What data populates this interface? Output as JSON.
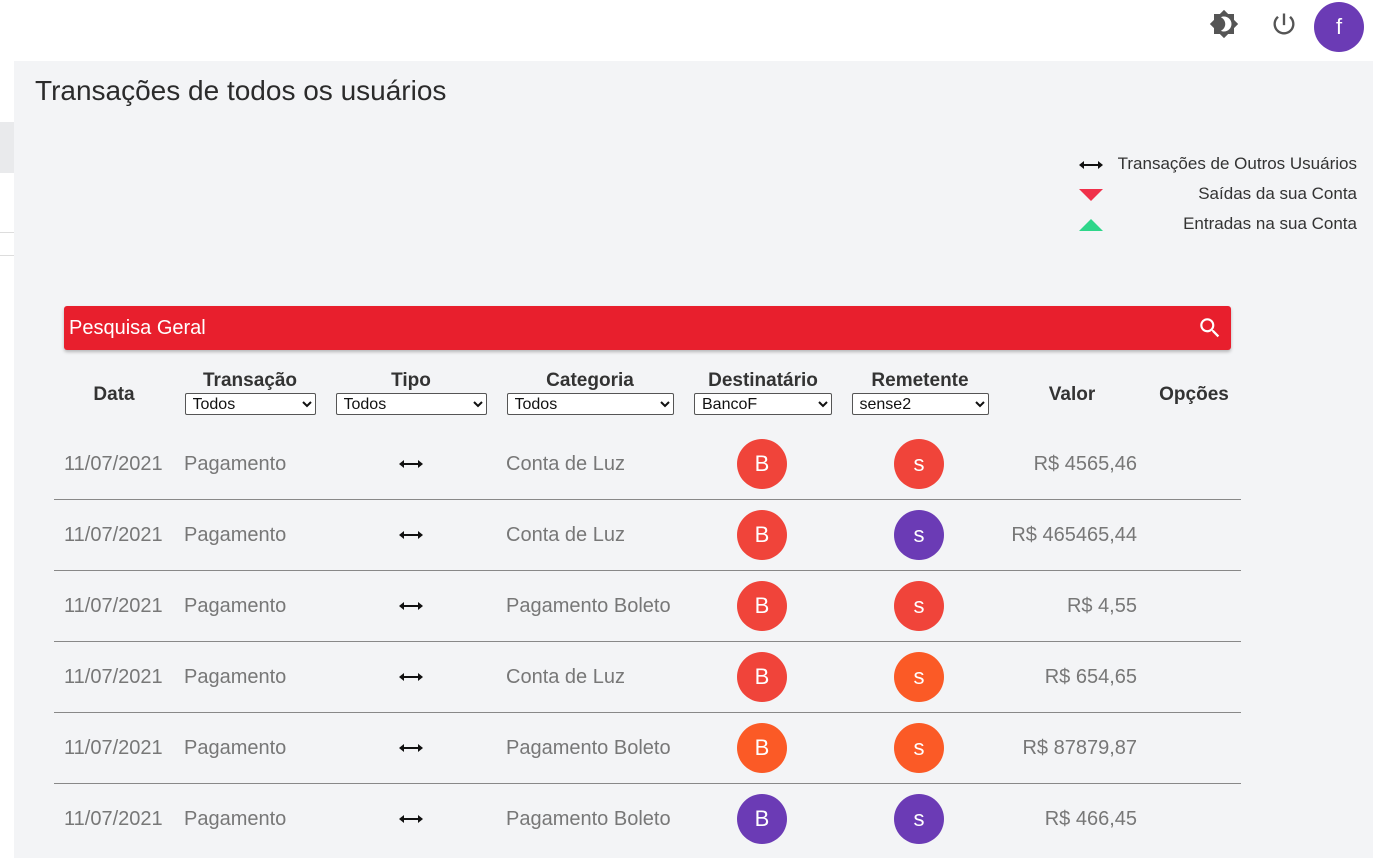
{
  "header": {
    "theme_icon": "brightness-icon",
    "power_icon": "power-icon",
    "user_initial": "f",
    "user_color": "#6b3bb5"
  },
  "page": {
    "title": "Transações de todos os usuários"
  },
  "legend": [
    {
      "icon": "double-arrow-icon",
      "label": "Transações de Outros Usuários"
    },
    {
      "icon": "triangle-down-icon",
      "label": "Saídas da sua Conta",
      "color": "#f0304a"
    },
    {
      "icon": "triangle-up-icon",
      "label": "Entradas na sua Conta",
      "color": "#2ed68a"
    }
  ],
  "search": {
    "placeholder": "Pesquisa Geral",
    "color": "#e81f2d"
  },
  "columns": {
    "data": "Data",
    "transacao": {
      "label": "Transação",
      "selected": "Todos"
    },
    "tipo": {
      "label": "Tipo",
      "selected": "Todos"
    },
    "categoria": {
      "label": "Categoria",
      "selected": "Todos"
    },
    "destinatario": {
      "label": "Destinatário",
      "selected": "BancoF"
    },
    "remetente": {
      "label": "Remetente",
      "selected": "sense2"
    },
    "valor": "Valor",
    "opcoes": "Opções"
  },
  "rows": [
    {
      "date": "11/07/2021",
      "transacao": "Pagamento",
      "categoria": "Conta de Luz",
      "dest_initial": "B",
      "dest_color": "#f0443a",
      "rem_initial": "s",
      "rem_color": "#f0443a",
      "valor": "R$ 4565,46"
    },
    {
      "date": "11/07/2021",
      "transacao": "Pagamento",
      "categoria": "Conta de Luz",
      "dest_initial": "B",
      "dest_color": "#f0443a",
      "rem_initial": "s",
      "rem_color": "#6b3bb5",
      "valor": "R$ 465465,44"
    },
    {
      "date": "11/07/2021",
      "transacao": "Pagamento",
      "categoria": "Pagamento Boleto",
      "dest_initial": "B",
      "dest_color": "#f0443a",
      "rem_initial": "s",
      "rem_color": "#f0443a",
      "valor": "R$ 4,55"
    },
    {
      "date": "11/07/2021",
      "transacao": "Pagamento",
      "categoria": "Conta de Luz",
      "dest_initial": "B",
      "dest_color": "#f0443a",
      "rem_initial": "s",
      "rem_color": "#fb5a26",
      "valor": "R$ 654,65"
    },
    {
      "date": "11/07/2021",
      "transacao": "Pagamento",
      "categoria": "Pagamento Boleto",
      "dest_initial": "B",
      "dest_color": "#fb5a26",
      "rem_initial": "s",
      "rem_color": "#fb5a26",
      "valor": "R$ 87879,87"
    },
    {
      "date": "11/07/2021",
      "transacao": "Pagamento",
      "categoria": "Pagamento Boleto",
      "dest_initial": "B",
      "dest_color": "#6b3bb5",
      "rem_initial": "s",
      "rem_color": "#6b3bb5",
      "valor": "R$ 466,45"
    }
  ]
}
